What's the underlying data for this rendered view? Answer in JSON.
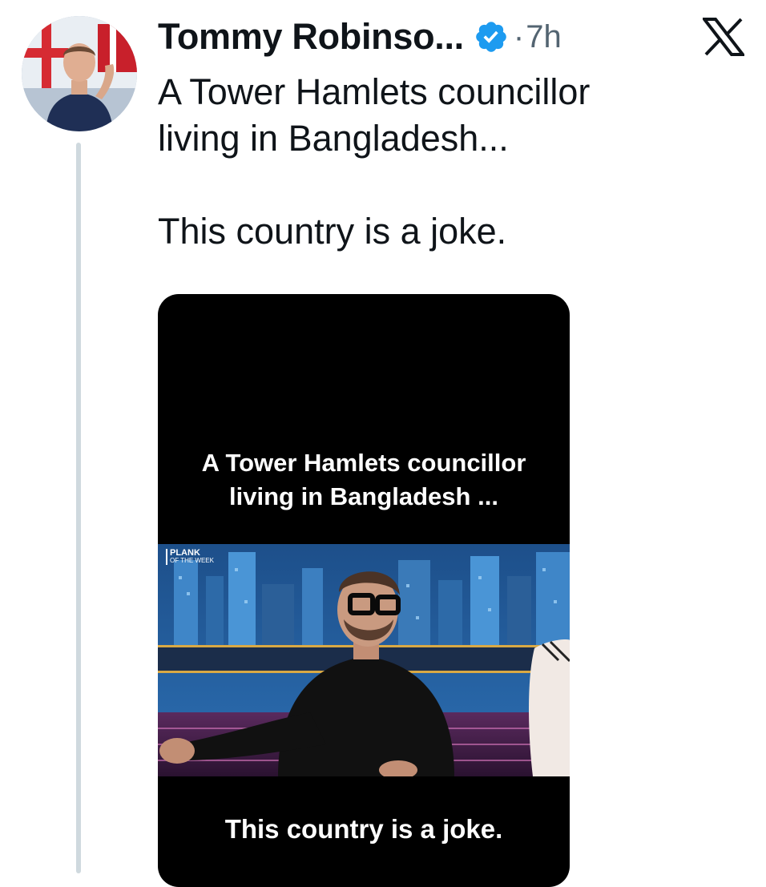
{
  "tweet": {
    "display_name": "Tommy Robinso...",
    "separator": "·",
    "timestamp": "7h",
    "text_line1": "A Tower Hamlets councillor",
    "text_line2": "living in Bangladesh...",
    "text_line3": "This country is a joke."
  },
  "media": {
    "caption_top_line1": "A Tower Hamlets councillor",
    "caption_top_line2": "living in Bangladesh ...",
    "caption_bottom": "This country is a joke.",
    "logo_line1": "PLANK",
    "logo_line2": "OF THE WEEK"
  },
  "icons": {
    "verified": "verified-badge-icon",
    "x_logo": "x-logo-icon"
  },
  "colors": {
    "verified_blue": "#1d9bf0",
    "secondary_text": "#536471",
    "thread_line": "#cfd9de",
    "media_background": "#000000"
  }
}
